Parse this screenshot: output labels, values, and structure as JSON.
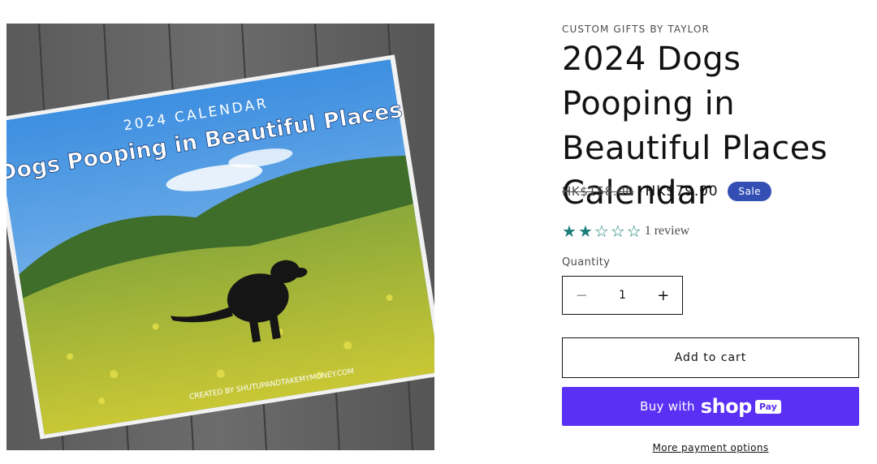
{
  "product": {
    "vendor": "CUSTOM GIFTS BY TAYLOR",
    "title": "2024 Dogs Pooping in Beautiful Places Calendar",
    "price_regular": "HK$158.00",
    "price_sale": "HK$79.00",
    "sale_badge": "Sale",
    "rating": {
      "value": 2,
      "max": 5,
      "review_text": "1 review"
    },
    "quantity": {
      "label": "Quantity",
      "value": "1",
      "decrease_symbol": "−",
      "increase_symbol": "+"
    },
    "add_to_cart_label": "Add to cart",
    "shop_pay": {
      "prefix": "Buy with",
      "brand": "shop",
      "pay_badge": "Pay"
    },
    "more_payment_options": "More payment options"
  },
  "media": {
    "icon": "product-photo",
    "calendar_overline": "2024 CALENDAR",
    "calendar_title": "Dogs Pooping in Beautiful Places",
    "calendar_credit": "CREATED BY  SHUTUPANDTAKEMYMONEY.COM"
  },
  "colors": {
    "text": "#121212",
    "muted": "#4d4d4d",
    "sale_badge": "#334fb4",
    "star": "#1d7f7a",
    "shop_pay": "#5a31f4"
  }
}
